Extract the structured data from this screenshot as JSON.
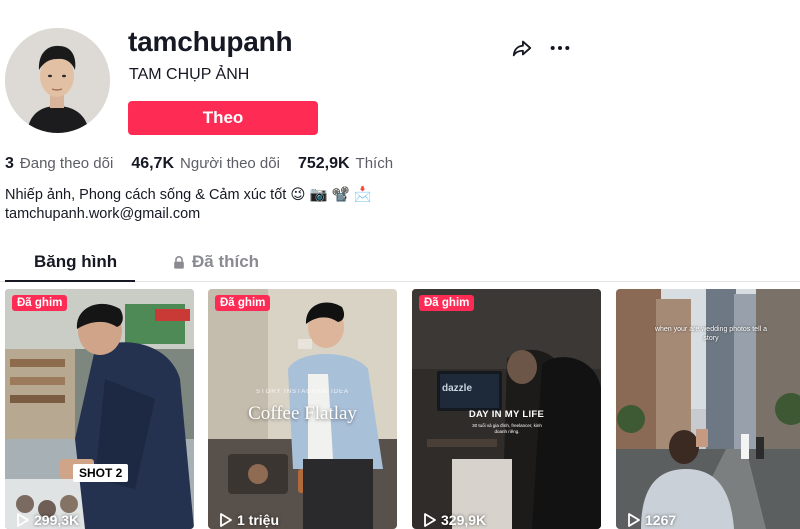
{
  "profile": {
    "username": "tamchupanh",
    "nickname": "TAM CHỤP ẢNH",
    "follow_label": "Theo",
    "follow_color": "#fe2c55"
  },
  "stats": {
    "following_count": "3",
    "following_label": "Đang theo dõi",
    "followers_count": "46,7K",
    "followers_label": "Người theo dõi",
    "likes_count": "752,9K",
    "likes_label": "Thích"
  },
  "bio": {
    "line1": "Nhiếp ảnh, Phong cách sống & Cảm xúc tốt 😉 📷 📽️ 📩",
    "email": "tamchupanh.work@gmail.com"
  },
  "tabs": {
    "videos_label": "Băng hình",
    "liked_label": "Đã thích"
  },
  "icons": {
    "share": "share-icon",
    "more": "more-icon",
    "lock": "lock-icon",
    "play": "play-icon"
  },
  "videos": [
    {
      "pinned": "Đã ghim",
      "views": "299,3K",
      "overlay": "SHOT 2"
    },
    {
      "pinned": "Đã ghim",
      "views": "1 triệu",
      "overlay": "Coffee Flatlay",
      "overlay_small": "STORY INSTAGRAM IDEA"
    },
    {
      "pinned": "Đã ghim",
      "views": "329,9K",
      "overlay": "DAY IN MY LIFE",
      "overlay_small": "30 tuổi và gia đình, freelancer, kinh doanh riêng.",
      "screen_text": "dazzle"
    },
    {
      "views": "1267",
      "overlay": "when your are wedding photos tell a story"
    }
  ]
}
